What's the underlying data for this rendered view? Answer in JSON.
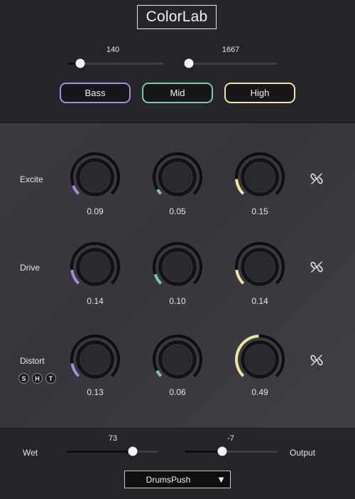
{
  "app": {
    "title": "ColorLab"
  },
  "crossover": {
    "low": {
      "value_label": "140",
      "fraction": 0.1
    },
    "high": {
      "value_label": "1667",
      "fraction": 0.0
    }
  },
  "bands": [
    {
      "label": "Bass",
      "color": "#a98cdc"
    },
    {
      "label": "Mid",
      "color": "#79c9b0"
    },
    {
      "label": "High",
      "color": "#f0e3a3"
    }
  ],
  "rows": [
    {
      "label": "Excite",
      "values": [
        "0.09",
        "0.05",
        "0.15"
      ],
      "amounts": [
        0.09,
        0.05,
        0.15
      ]
    },
    {
      "label": "Drive",
      "values": [
        "0.14",
        "0.10",
        "0.14"
      ],
      "amounts": [
        0.14,
        0.1,
        0.14
      ]
    },
    {
      "label": "Distort",
      "values": [
        "0.13",
        "0.06",
        "0.49"
      ],
      "amounts": [
        0.13,
        0.06,
        0.49
      ]
    }
  ],
  "distort_modes": [
    "S",
    "H",
    "T"
  ],
  "icons": {
    "link": "unlink-icon",
    "caret": "caret-down-icon"
  },
  "footer": {
    "wet": {
      "label": "Wet",
      "value_label": "73",
      "fraction": 0.73
    },
    "output": {
      "label": "Output",
      "value_label": "-7",
      "fraction": 0.41
    },
    "preset": "DrumsPush",
    "caret": "▼"
  }
}
